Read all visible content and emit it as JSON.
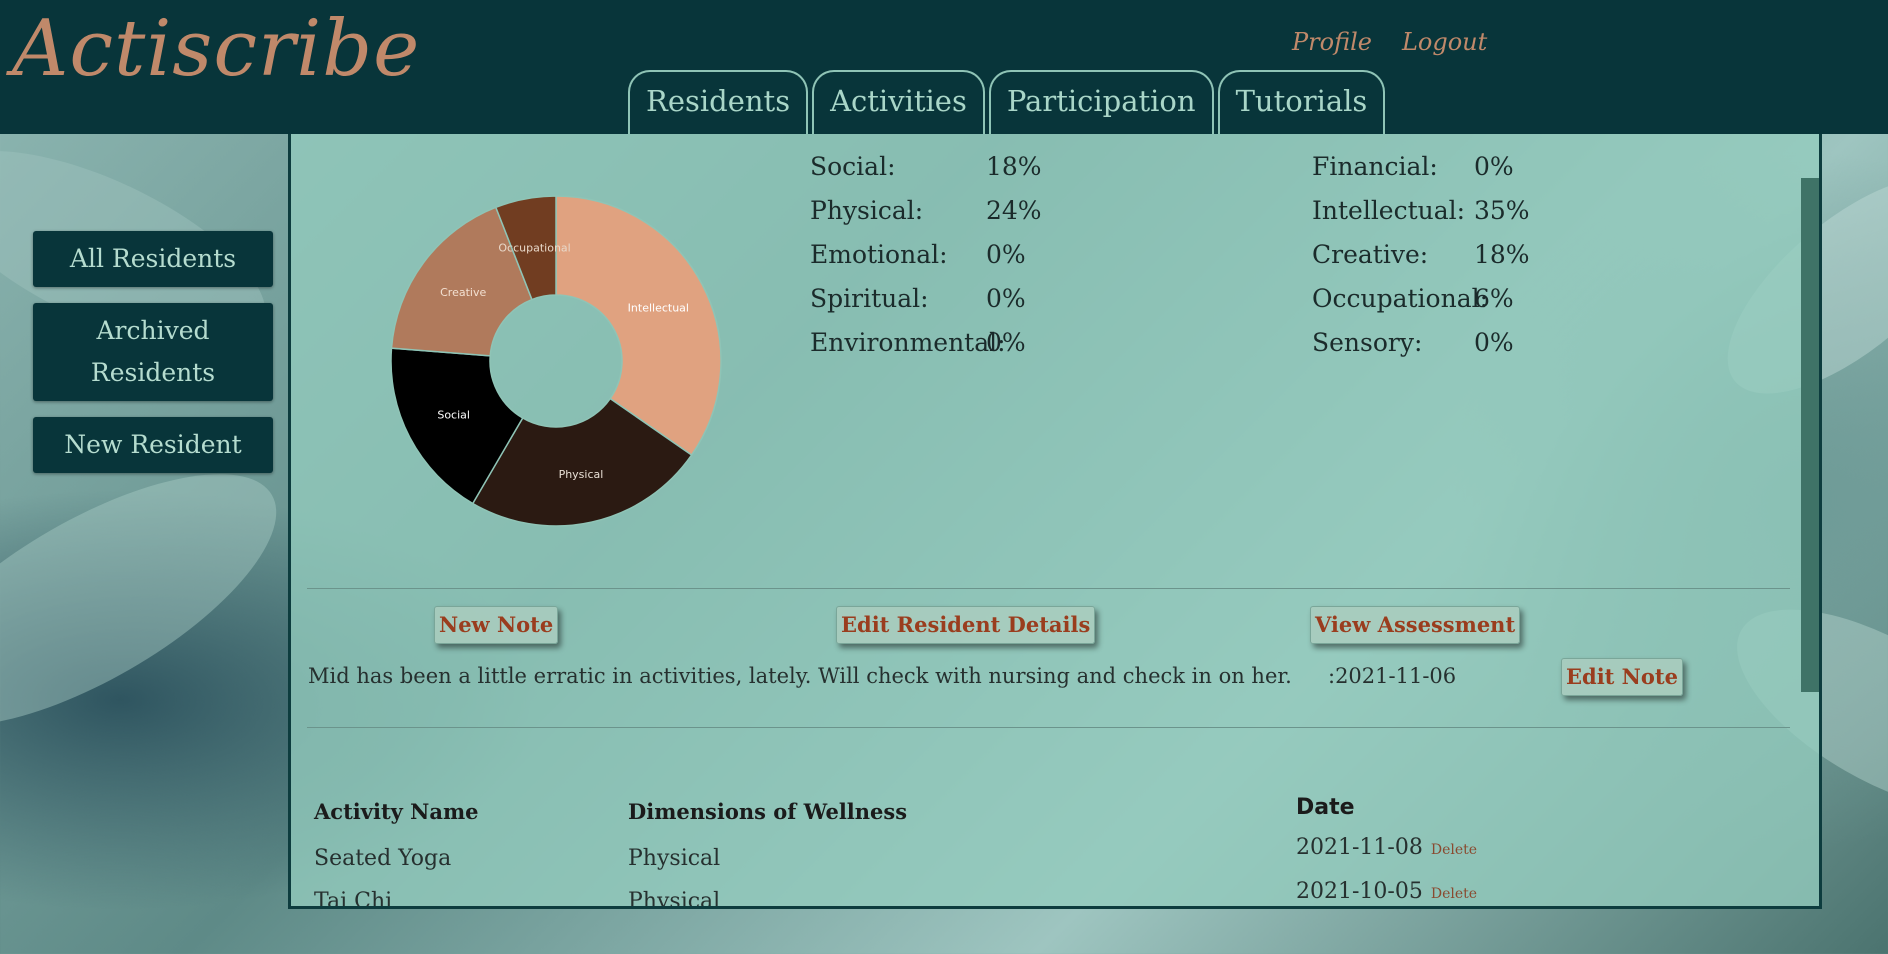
{
  "app": {
    "logo": "Actiscribe"
  },
  "header": {
    "links": [
      {
        "label": "Profile"
      },
      {
        "label": "Logout"
      }
    ],
    "tabs": [
      {
        "label": "Residents"
      },
      {
        "label": "Activities"
      },
      {
        "label": "Participation"
      },
      {
        "label": "Tutorials"
      }
    ]
  },
  "sidebar": {
    "buttons": [
      {
        "label": "All Residents"
      },
      {
        "label": "Archived Residents"
      },
      {
        "label": "New Resident"
      }
    ]
  },
  "wellness": {
    "left": [
      {
        "label": "Social:",
        "value": "18%"
      },
      {
        "label": "Physical:",
        "value": "24%"
      },
      {
        "label": "Emotional:",
        "value": "0%"
      },
      {
        "label": "Spiritual:",
        "value": "0%"
      },
      {
        "label": "Environmental:",
        "value": "0%"
      }
    ],
    "right": [
      {
        "label": "Financial:",
        "value": "0%"
      },
      {
        "label": "Intellectual:",
        "value": "35%"
      },
      {
        "label": "Creative:",
        "value": "18%"
      },
      {
        "label": "Occupational:",
        "value": "6%"
      },
      {
        "label": "Sensory:",
        "value": "0%"
      }
    ]
  },
  "chart_data": {
    "type": "pie",
    "categories": [
      "Intellectual",
      "Physical",
      "Social",
      "Creative",
      "Occupational"
    ],
    "values": [
      35,
      24,
      18,
      18,
      6
    ],
    "colors": [
      "#e0a280",
      "#2b1a12",
      "#000000",
      "#b07a5c",
      "#713d21"
    ],
    "label_colors": [
      "#ffffff",
      "#e9e0d6",
      "#ffffff",
      "#f3e0d1",
      "#e8d8c9"
    ]
  },
  "actions": {
    "new_note": "New Note",
    "edit_resident": "Edit Resident Details",
    "view_assessment": "View Assessment",
    "edit_note": "Edit Note"
  },
  "note": {
    "text": "Mid has been a little erratic in activities, lately. Will check with nursing and check in on her.",
    "date": ":2021-11-06"
  },
  "activities_table": {
    "headers": {
      "name": "Activity Name",
      "dimensions": "Dimensions of Wellness",
      "date": "Date"
    },
    "rows": [
      {
        "name": "Seated Yoga",
        "dimension": "Physical",
        "date": "2021-11-08",
        "delete": "Delete"
      },
      {
        "name": "Tai Chi",
        "dimension": "Physical",
        "date": "2021-10-05",
        "delete": "Delete"
      }
    ]
  }
}
